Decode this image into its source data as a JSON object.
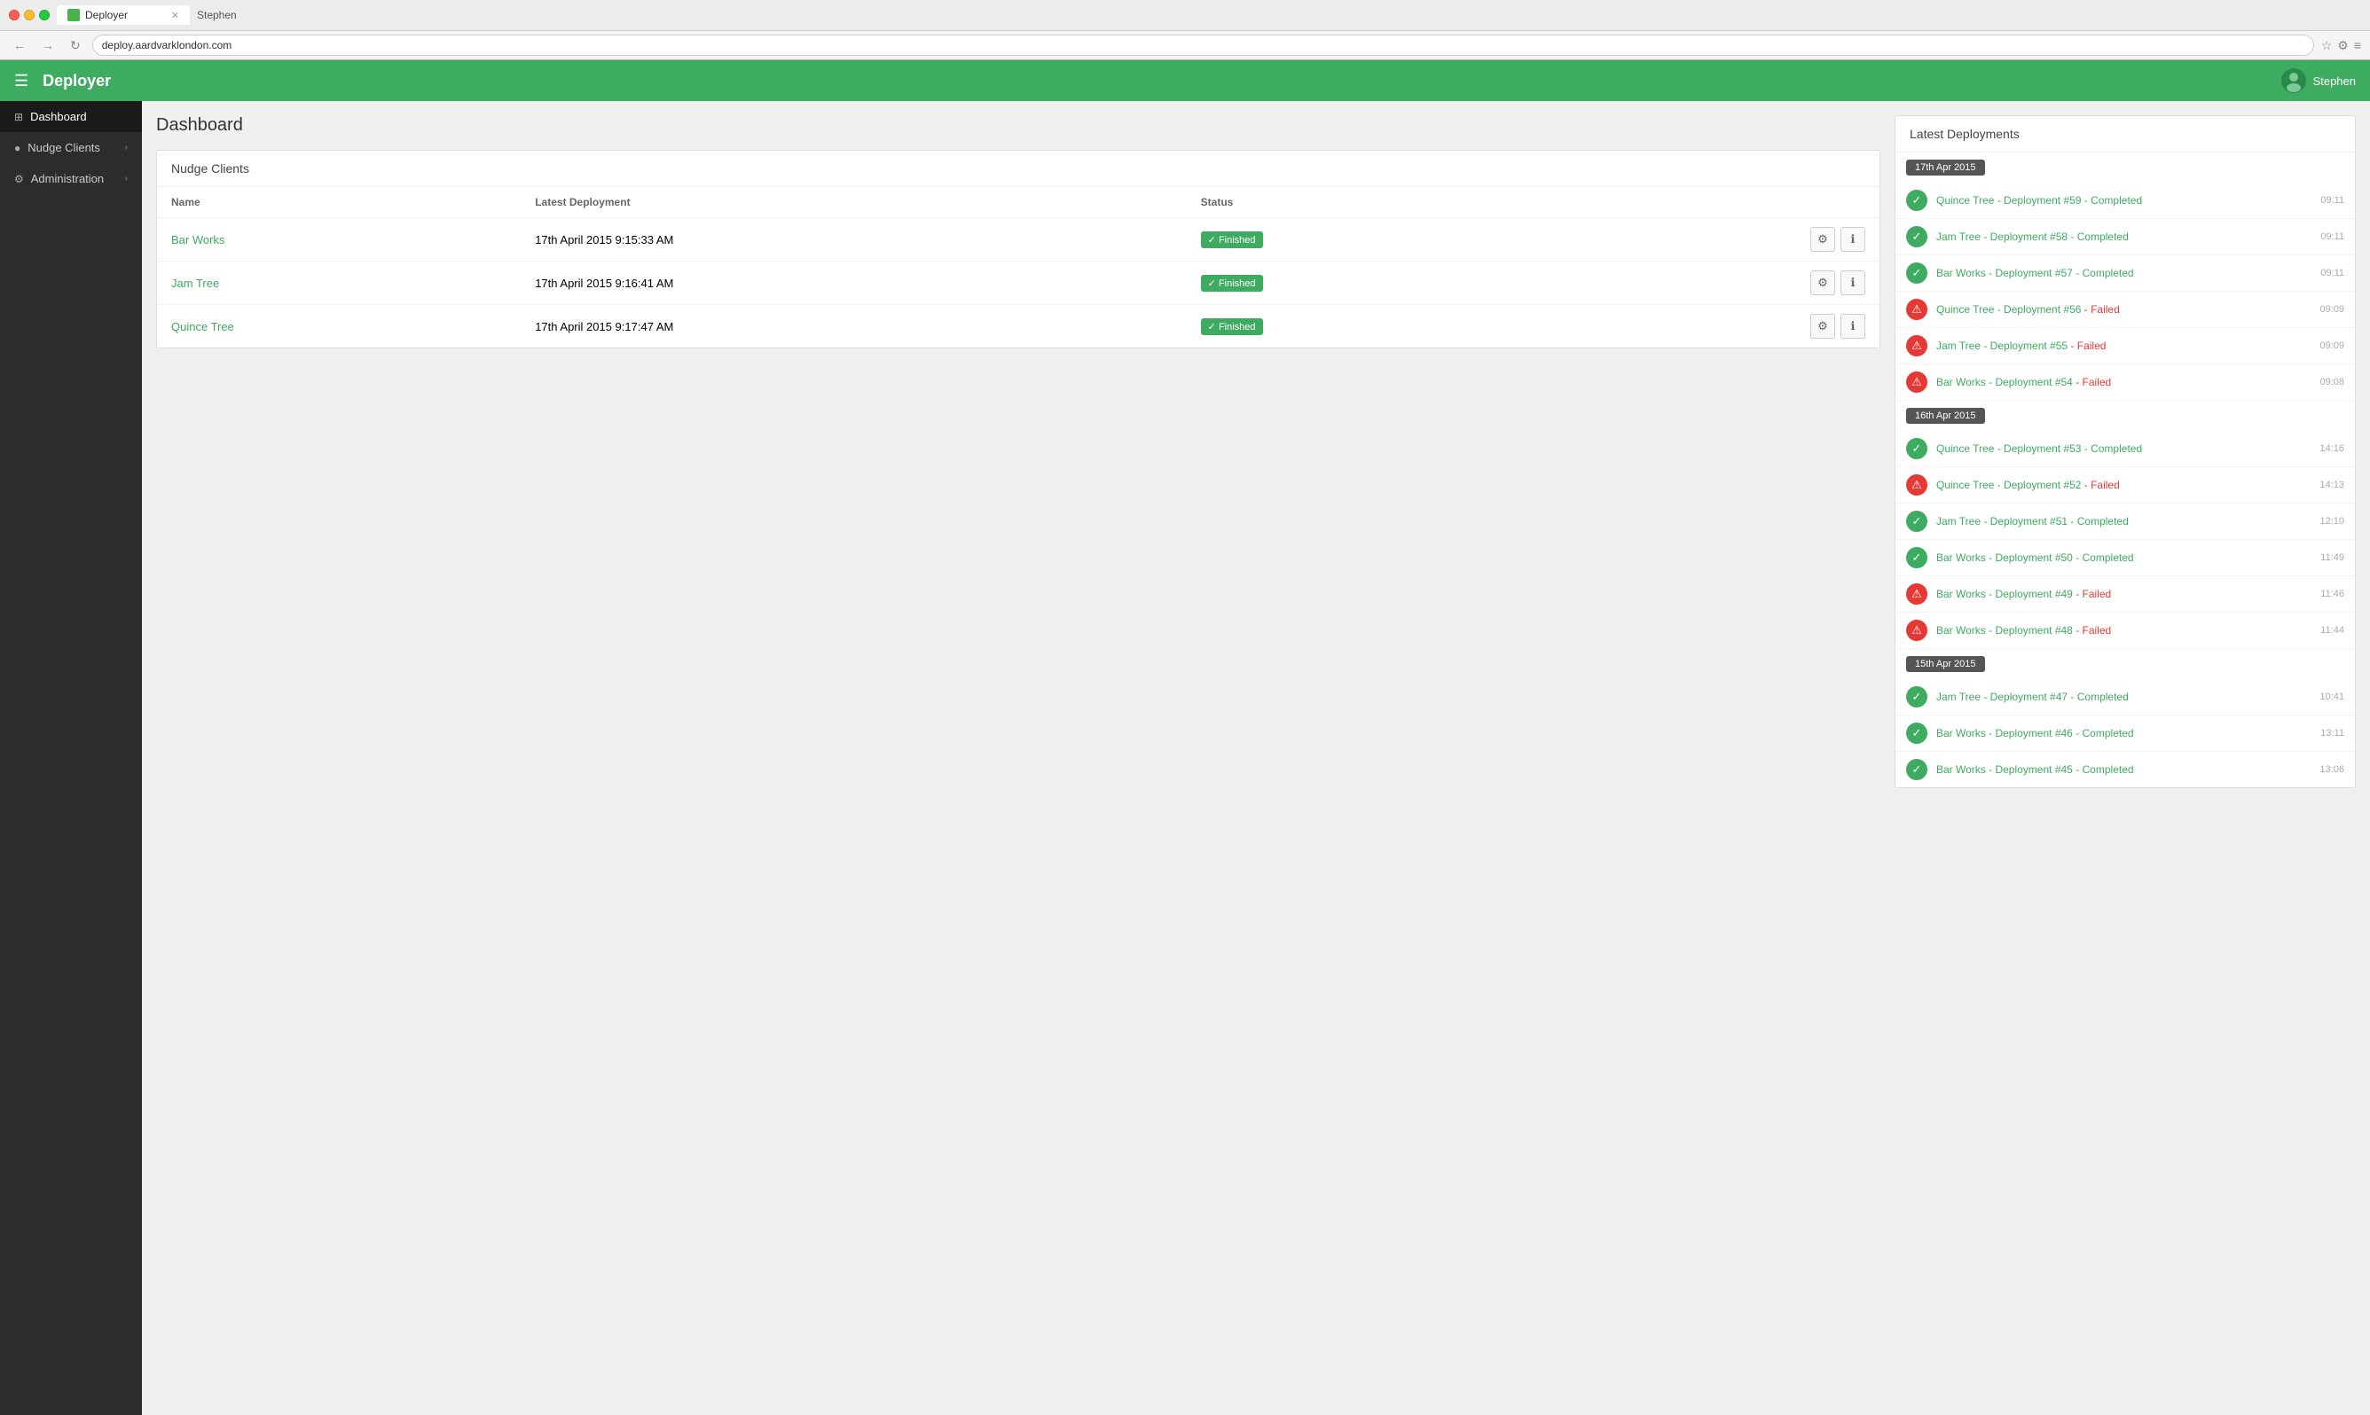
{
  "browser": {
    "tab_title": "Deployer",
    "address": "deploy.aardvarklondon.com",
    "user": "Stephen"
  },
  "topnav": {
    "brand": "Deployer",
    "user": "Stephen"
  },
  "sidebar": {
    "items": [
      {
        "id": "dashboard",
        "label": "Dashboard",
        "icon": "⊞",
        "active": true,
        "arrow": false
      },
      {
        "id": "nudge-clients",
        "label": "Nudge Clients",
        "icon": "●",
        "active": false,
        "arrow": true
      },
      {
        "id": "administration",
        "label": "Administration",
        "icon": "⚙",
        "active": false,
        "arrow": true
      }
    ]
  },
  "main": {
    "page_title": "Dashboard",
    "nudge_clients": {
      "section_title": "Nudge Clients",
      "table_headers": [
        "Name",
        "Latest Deployment",
        "Status",
        ""
      ],
      "clients": [
        {
          "name": "Bar Works",
          "deployment": "17th April 2015 9:15:33 AM",
          "status": "Finished"
        },
        {
          "name": "Jam Tree",
          "deployment": "17th April 2015 9:16:41 AM",
          "status": "Finished"
        },
        {
          "name": "Quince Tree",
          "deployment": "17th April 2015 9:17:47 AM",
          "status": "Finished"
        }
      ]
    },
    "latest_deployments": {
      "section_title": "Latest Deployments",
      "groups": [
        {
          "date": "17th Apr 2015",
          "deployments": [
            {
              "name": "Quince Tree",
              "number": "#59",
              "status": "Completed",
              "time": "09:11"
            },
            {
              "name": "Jam Tree",
              "number": "#58",
              "status": "Completed",
              "time": "09:11"
            },
            {
              "name": "Bar Works",
              "number": "#57",
              "status": "Completed",
              "time": "09:11"
            },
            {
              "name": "Quince Tree",
              "number": "#56",
              "status": "Failed",
              "time": "09:09"
            },
            {
              "name": "Jam Tree",
              "number": "#55",
              "status": "Failed",
              "time": "09:09"
            },
            {
              "name": "Bar Works",
              "number": "#54",
              "status": "Failed",
              "time": "09:08"
            }
          ]
        },
        {
          "date": "16th Apr 2015",
          "deployments": [
            {
              "name": "Quince Tree",
              "number": "#53",
              "status": "Completed",
              "time": "14:16"
            },
            {
              "name": "Quince Tree",
              "number": "#52",
              "status": "Failed",
              "time": "14:13"
            },
            {
              "name": "Jam Tree",
              "number": "#51",
              "status": "Completed",
              "time": "12:10"
            },
            {
              "name": "Bar Works",
              "number": "#50",
              "status": "Completed",
              "time": "11:49"
            },
            {
              "name": "Bar Works",
              "number": "#49",
              "status": "Failed",
              "time": "11:46"
            },
            {
              "name": "Bar Works",
              "number": "#48",
              "status": "Failed",
              "time": "11:44"
            }
          ]
        },
        {
          "date": "15th Apr 2015",
          "deployments": [
            {
              "name": "Jam Tree",
              "number": "#47",
              "status": "Completed",
              "time": "10:41"
            },
            {
              "name": "Bar Works",
              "number": "#46",
              "status": "Completed",
              "time": "13:11"
            },
            {
              "name": "Bar Works",
              "number": "#45",
              "status": "Completed",
              "time": "13:06"
            }
          ]
        }
      ]
    }
  }
}
